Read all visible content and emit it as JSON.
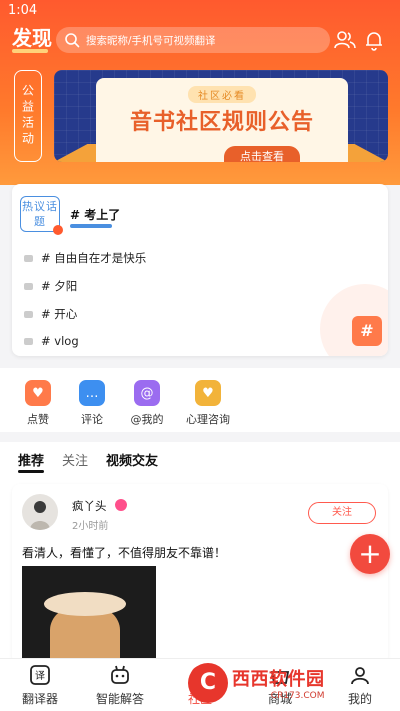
{
  "status": {
    "time": "1:04"
  },
  "header": {
    "title": "发现",
    "search_placeholder": "搜索昵称/手机号可视频翻译",
    "icons": [
      "user-group-icon",
      "bell-icon"
    ]
  },
  "activity": {
    "side_label": "公益活动",
    "banner_subtitle": "社区必看",
    "banner_title": "音书社区规则公告",
    "banner_button": "点击查看"
  },
  "topics": {
    "badge": "热议话题",
    "featured": "# 考上了",
    "list": [
      "# 自由自在才是快乐",
      "# 夕阳",
      "# 开心",
      "# vlog"
    ],
    "side_button": "#"
  },
  "quick_actions": [
    {
      "label": "点赞",
      "icon": "heart-icon",
      "color": "#ff7a4a"
    },
    {
      "label": "评论",
      "icon": "comment-icon",
      "color": "#3d8ff0"
    },
    {
      "label": "@我的",
      "icon": "at-icon",
      "color": "#9b6cf0"
    },
    {
      "label": "心理咨询",
      "icon": "heart-hand-icon",
      "color": "#f2b33a"
    }
  ],
  "feed": {
    "tabs": [
      "推荐",
      "关注",
      "视频交友"
    ],
    "post": {
      "author": "疯丫头",
      "time": "2小时前",
      "follow_label": "关注",
      "text": "看清人，看懂了，不值得朋友不靠谱！"
    }
  },
  "fab": {
    "label": "+"
  },
  "bottom_nav": [
    {
      "label": "翻译器",
      "icon": "translate-icon",
      "active": false
    },
    {
      "label": "智能解答",
      "icon": "robot-icon",
      "active": false
    },
    {
      "label": "社区",
      "icon": "community-icon",
      "active": true
    },
    {
      "label": "商城",
      "icon": "shop-icon",
      "active": false
    },
    {
      "label": "我的",
      "icon": "profile-icon",
      "active": false
    }
  ],
  "watermark": {
    "logo": "C",
    "main": "西西软件园",
    "url": "CR173.COM"
  }
}
